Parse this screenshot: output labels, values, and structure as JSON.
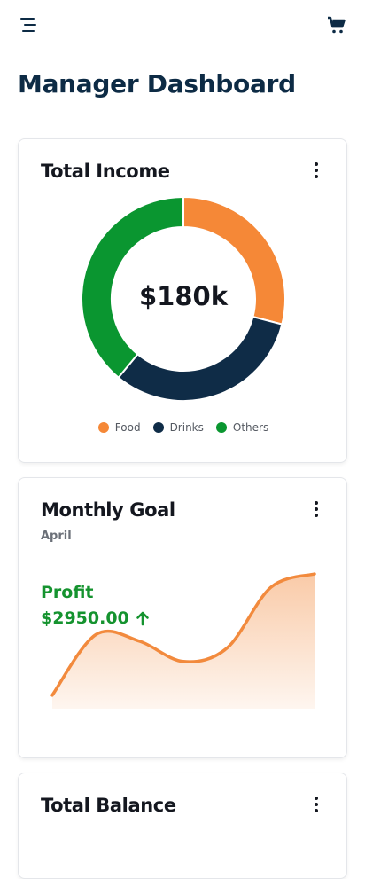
{
  "header": {
    "title": "Manager Dashboard",
    "menu_icon": "hamburger-menu-icon",
    "cart_icon": "shopping-cart-icon"
  },
  "income_card": {
    "title": "Total Income",
    "center_value": "$180k",
    "more_icon": "more-vertical-icon",
    "legend": [
      {
        "label": "Food",
        "color": "#f58837"
      },
      {
        "label": "Drinks",
        "color": "#0f2c47"
      },
      {
        "label": "Others",
        "color": "#0a9630"
      }
    ]
  },
  "goal_card": {
    "title": "Monthly Goal",
    "subtitle": "April",
    "profit_label": "Profit",
    "profit_value": "$2950.00",
    "trend_icon": "arrow-up-icon",
    "more_icon": "more-vertical-icon"
  },
  "balance_card": {
    "title": "Total Balance",
    "more_icon": "more-vertical-icon"
  },
  "chart_data": [
    {
      "type": "pie",
      "categories": [
        "Food",
        "Drinks",
        "Others"
      ],
      "values": [
        29,
        32,
        39
      ],
      "colors": [
        "#f58837",
        "#0f2c47",
        "#0a9630"
      ],
      "center_label": "$180k",
      "legend": "bottom"
    },
    {
      "type": "area",
      "x": [
        0,
        1,
        2,
        3,
        4,
        5,
        6
      ],
      "values": [
        0.1,
        0.55,
        0.5,
        0.35,
        0.45,
        0.9,
        1.0
      ],
      "color": "#f28a3d",
      "grid": false
    }
  ]
}
